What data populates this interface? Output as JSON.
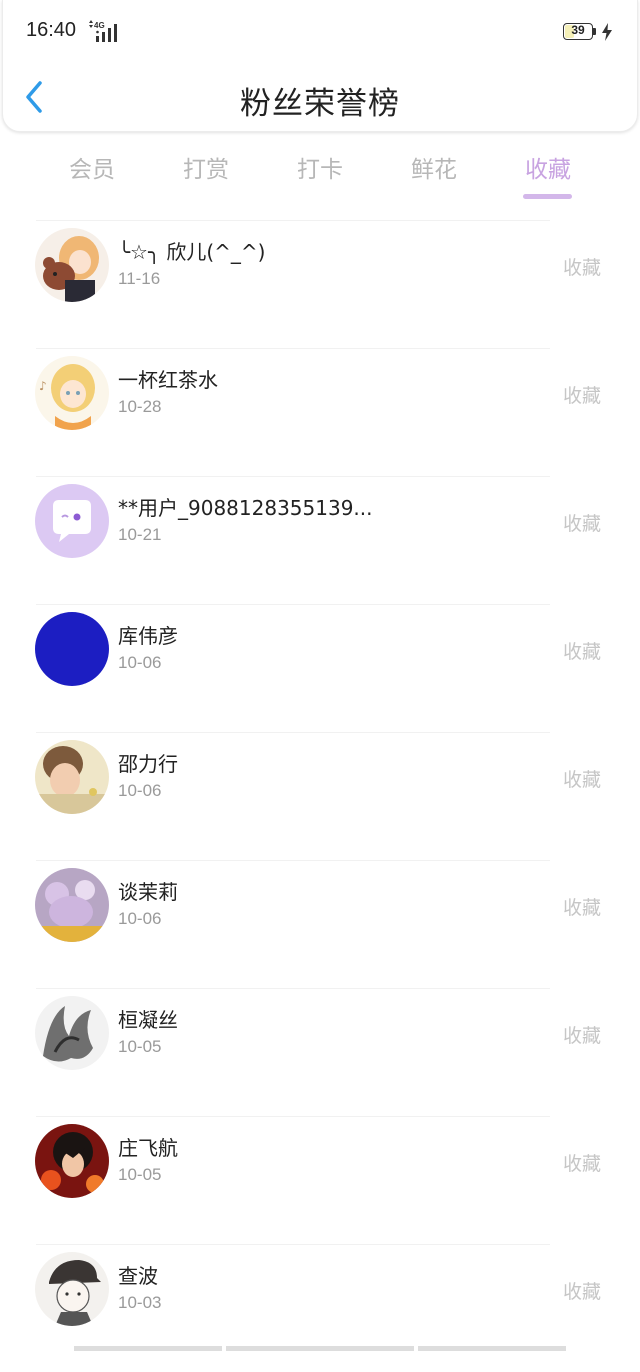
{
  "status": {
    "time": "16:40",
    "network": "4G",
    "battery": "39",
    "battery_level": 0.39
  },
  "header": {
    "title": "粉丝荣誉榜"
  },
  "tabs": [
    {
      "label": "会员",
      "active": false
    },
    {
      "label": "打赏",
      "active": false
    },
    {
      "label": "打卡",
      "active": false
    },
    {
      "label": "鲜花",
      "active": false
    },
    {
      "label": "收藏",
      "active": true
    }
  ],
  "colors": {
    "accent": "#c8a3e1",
    "tab_inactive": "#b7b7b7",
    "back_arrow": "#2f9be8"
  },
  "fans": [
    {
      "name": "╰☆╮ 欣儿(^_^)",
      "date": "11-16",
      "action": "收藏",
      "avatar": "anime-girl-teddy-avatar"
    },
    {
      "name": "一杯红茶水",
      "date": "10-28",
      "action": "收藏",
      "avatar": "anime-blonde-avatar"
    },
    {
      "name": "**用户_9088128355139...",
      "date": "10-21",
      "action": "收藏",
      "avatar": "chat-bubble-avatar"
    },
    {
      "name": "库伟彦",
      "date": "10-06",
      "action": "收藏",
      "avatar": "blue-circle-avatar"
    },
    {
      "name": "邵力行",
      "date": "10-06",
      "action": "收藏",
      "avatar": "child-photo-avatar"
    },
    {
      "name": "谈茉莉",
      "date": "10-06",
      "action": "收藏",
      "avatar": "plush-toy-avatar"
    },
    {
      "name": "桓凝丝",
      "date": "10-05",
      "action": "收藏",
      "avatar": "ink-sketch-avatar"
    },
    {
      "name": "庄飞航",
      "date": "10-05",
      "action": "收藏",
      "avatar": "dark-hair-anime-avatar"
    },
    {
      "name": "查波",
      "date": "10-03",
      "action": "收藏",
      "avatar": "cap-boy-avatar"
    }
  ]
}
